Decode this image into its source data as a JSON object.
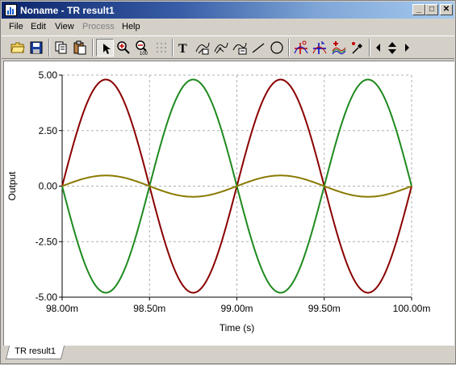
{
  "window": {
    "title": "Noname - TR result1",
    "caption_buttons": {
      "minimize": "_",
      "maximize": "□",
      "close": "✕"
    }
  },
  "menu": [
    {
      "label": "File",
      "enabled": true
    },
    {
      "label": "Edit",
      "enabled": true
    },
    {
      "label": "View",
      "enabled": true
    },
    {
      "label": "Process",
      "enabled": false
    },
    {
      "label": "Help",
      "enabled": true
    }
  ],
  "toolbar": {
    "icons": [
      "open-folder-icon",
      "save-icon",
      "copy-icon",
      "paste-icon",
      "select-arrow-icon",
      "zoom-in-icon",
      "zoom-out-icon",
      "grid-icon",
      "text-tool-icon",
      "curve-cursor-a-icon",
      "curve-cursor-b-icon",
      "curve-label-icon",
      "line-tool-icon",
      "ellipse-tool-icon",
      "cursor-a-icon",
      "cursor-b-icon",
      "add-curves-icon",
      "color-picker-icon",
      "pan-left-icon",
      "pan-up-down-icon",
      "pan-right-icon"
    ],
    "zoom_out_label": "100",
    "text_tool_label": "T"
  },
  "tab": {
    "label": "TR result1"
  },
  "chart_data": {
    "type": "line",
    "xlabel": "Time (s)",
    "ylabel": "Output",
    "xlim": [
      98.0,
      100.0
    ],
    "ylim": [
      -5.0,
      5.0
    ],
    "x_unit_suffix": "m",
    "x_ticks": [
      98.0,
      98.5,
      99.0,
      99.5,
      100.0
    ],
    "x_tick_labels": [
      "98.00m",
      "98.50m",
      "99.00m",
      "99.50m",
      "100.00m"
    ],
    "y_ticks": [
      5.0,
      2.5,
      0.0,
      -2.5,
      -5.0
    ],
    "y_tick_labels": [
      "5.00",
      "2.50",
      "0.00",
      "-2.50",
      "-5.00"
    ],
    "grid": true,
    "series": [
      {
        "color": "#8b0000",
        "amplitude": 4.8,
        "frequency_per_ms": 1.0,
        "phase": "sin",
        "x": [
          98.0,
          98.25,
          98.5,
          98.75,
          99.0,
          99.25,
          99.5,
          99.75,
          100.0
        ],
        "values": [
          0.0,
          4.8,
          0.0,
          -4.8,
          0.0,
          4.8,
          0.0,
          -4.8,
          0.0
        ]
      },
      {
        "color": "#1e8a1e",
        "amplitude": 4.8,
        "frequency_per_ms": 1.0,
        "phase": "-sin",
        "x": [
          98.0,
          98.25,
          98.5,
          98.75,
          99.0,
          99.25,
          99.5,
          99.75,
          100.0
        ],
        "values": [
          0.0,
          -4.8,
          0.0,
          4.8,
          0.0,
          -4.8,
          0.0,
          4.8,
          0.0
        ]
      },
      {
        "color": "#8a7a00",
        "amplitude": 0.48,
        "frequency_per_ms": 1.0,
        "phase": "sin",
        "x": [
          98.0,
          98.25,
          98.5,
          98.75,
          99.0,
          99.25,
          99.5,
          99.75,
          100.0
        ],
        "values": [
          0.0,
          0.48,
          0.0,
          -0.48,
          0.0,
          0.48,
          0.0,
          -0.48,
          0.0
        ]
      }
    ]
  }
}
